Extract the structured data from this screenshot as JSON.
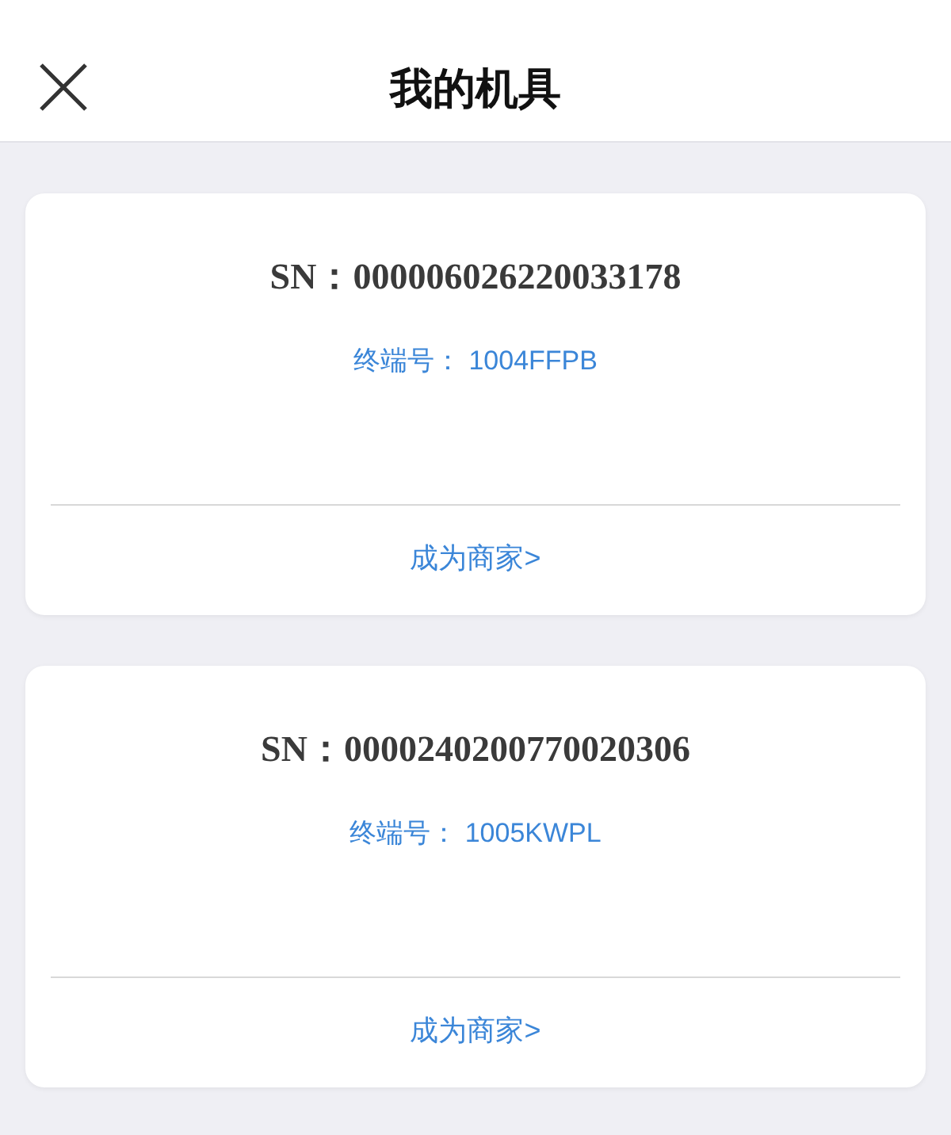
{
  "header": {
    "title": "我的机具"
  },
  "devices": [
    {
      "sn": "SN：000006026220033178",
      "terminal": "终端号： 1004FFPB",
      "action": "成为商家>"
    },
    {
      "sn": "SN：0000240200770020306",
      "terminal": "终端号： 1005KWPL",
      "action": "成为商家>"
    }
  ]
}
